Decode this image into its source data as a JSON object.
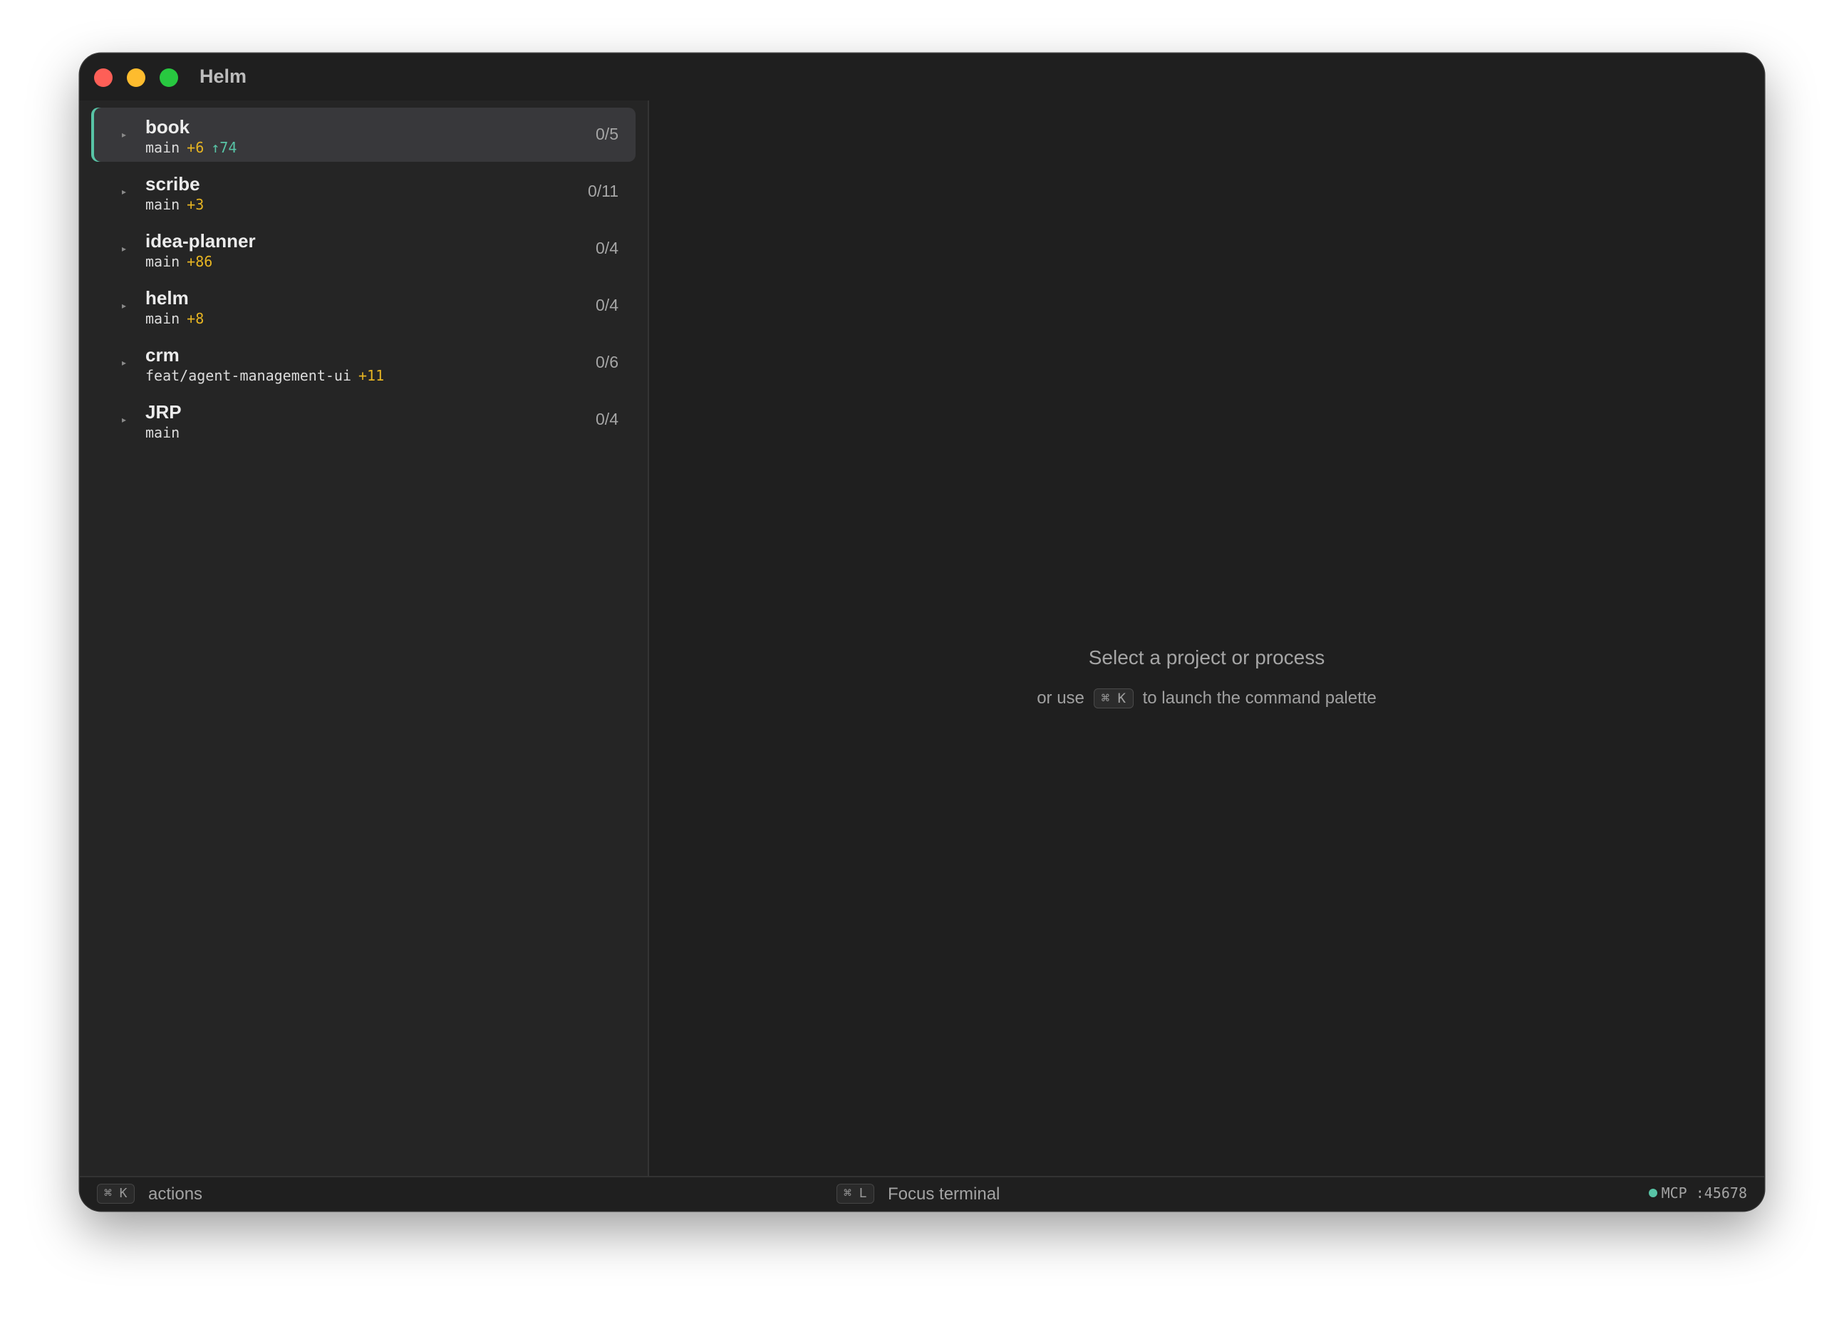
{
  "window": {
    "title": "Helm"
  },
  "projects": [
    {
      "name": "book",
      "branch": "main",
      "changes": "+6",
      "ahead": "↑74",
      "count": "0/5",
      "selected": true
    },
    {
      "name": "scribe",
      "branch": "main",
      "changes": "+3",
      "ahead": "",
      "count": "0/11",
      "selected": false
    },
    {
      "name": "idea-planner",
      "branch": "main",
      "changes": "+86",
      "ahead": "",
      "count": "0/4",
      "selected": false
    },
    {
      "name": "helm",
      "branch": "main",
      "changes": "+8",
      "ahead": "",
      "count": "0/4",
      "selected": false
    },
    {
      "name": "crm",
      "branch": "feat/agent-management-ui",
      "changes": "+11",
      "ahead": "",
      "count": "0/6",
      "selected": false
    },
    {
      "name": "JRP",
      "branch": "main",
      "changes": "",
      "ahead": "",
      "count": "0/4",
      "selected": false
    }
  ],
  "caret_glyph": "▸",
  "empty_state": {
    "title": "Select a project or process",
    "hint_prefix": "or use",
    "hint_key": "⌘ K",
    "hint_suffix": "to launch the command palette"
  },
  "statusbar": {
    "actions_key": "⌘ K",
    "actions_label": "actions",
    "focus_key": "⌘ L",
    "focus_label": "Focus terminal",
    "mcp_label": "MCP :45678"
  },
  "colors": {
    "accent": "#58c4a6",
    "changes": "#e6b422",
    "window_bg": "#1f1f1f",
    "sidebar_bg": "#252525",
    "selected_row_bg": "#38383b"
  }
}
